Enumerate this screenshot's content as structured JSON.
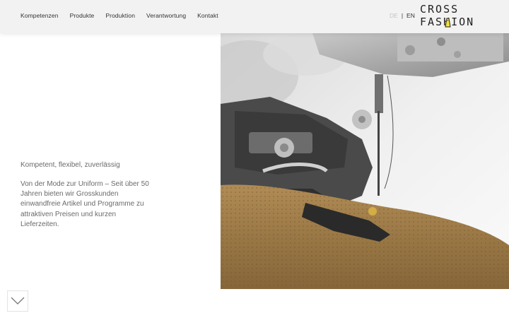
{
  "nav": {
    "items": [
      {
        "label": "Kompetenzen"
      },
      {
        "label": "Produkte"
      },
      {
        "label": "Produktion"
      },
      {
        "label": "Verantwortung"
      },
      {
        "label": "Kontakt"
      }
    ]
  },
  "lang": {
    "de": "DE",
    "separator": "|",
    "en": "EN"
  },
  "logo": {
    "line1": "CROSS",
    "line2": "FASHION"
  },
  "main": {
    "tagline": "Kompetent, flexibel, zuverlässig",
    "description": "Von der Mode zur Uniform – Seit über 50 Jahren bieten wir Grosskunden einwandfreie Artikel und Programme zu attraktiven Preisen und kurzen Lieferzeiten."
  },
  "icons": {
    "scroll": "chevron-down-icon"
  },
  "colors": {
    "header_bg": "#f2f2f2",
    "logo_accent": "#f3e23a",
    "text": "#6a6a6a"
  }
}
